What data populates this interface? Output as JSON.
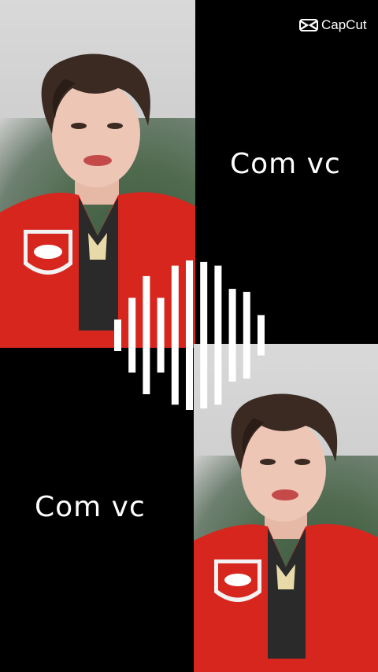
{
  "watermark": {
    "brand_text": "CapCut",
    "icon": "capcut-logo-icon"
  },
  "captions": {
    "top": "Com vc",
    "bottom": "Com vc"
  },
  "audio_visualizer": {
    "bar_count": 11,
    "levels": [
      0.21,
      0.5,
      0.79,
      0.5,
      0.93,
      1.0,
      0.98,
      0.93,
      0.62,
      0.58,
      0.27
    ]
  },
  "colors": {
    "background": "#000000",
    "vest_red": "#d7261e",
    "text": "#ffffff"
  }
}
